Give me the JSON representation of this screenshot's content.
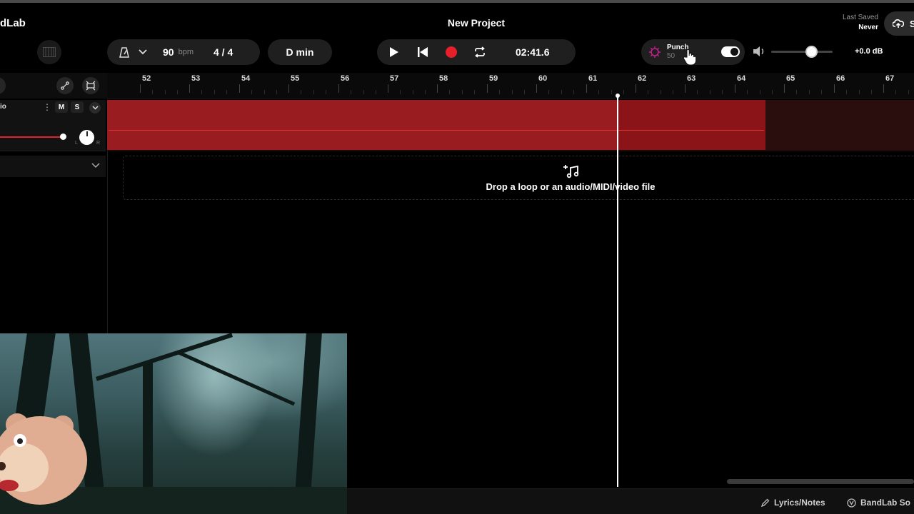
{
  "app": {
    "name": "dLab",
    "project_title": "New Project"
  },
  "save": {
    "last_saved_label": "Last Saved",
    "last_saved_value": "Never",
    "save_label": "S"
  },
  "toolbar": {
    "tempo_value": "90",
    "tempo_unit": "bpm",
    "time_signature": "4 / 4",
    "key": "D min",
    "time_display": "02:41.6",
    "punch_label": "Punch",
    "punch_value": "50",
    "punch_enabled": true,
    "master_volume_db": "+0.0 dB",
    "master_volume_level": 0.66
  },
  "track": {
    "name": "io",
    "menu_icon": "vertical-dots-icon",
    "mute_label": "M",
    "solo_label": "S",
    "pan_left": "L",
    "pan_right": "R",
    "region_color": "#8b1418"
  },
  "timeline": {
    "bars": [
      "52",
      "53",
      "54",
      "55",
      "56",
      "57",
      "58",
      "59",
      "60",
      "61",
      "62",
      "63",
      "64",
      "65",
      "66",
      "67"
    ],
    "drop_text": "Drop a loop or an audio/MIDI/video file"
  },
  "footer": {
    "lyrics_label": "Lyrics/Notes",
    "bandlab_label": "BandLab So"
  },
  "colors": {
    "record": "#e5202a",
    "accent": "#c01a1f",
    "punch_icon": "#c0208a"
  }
}
